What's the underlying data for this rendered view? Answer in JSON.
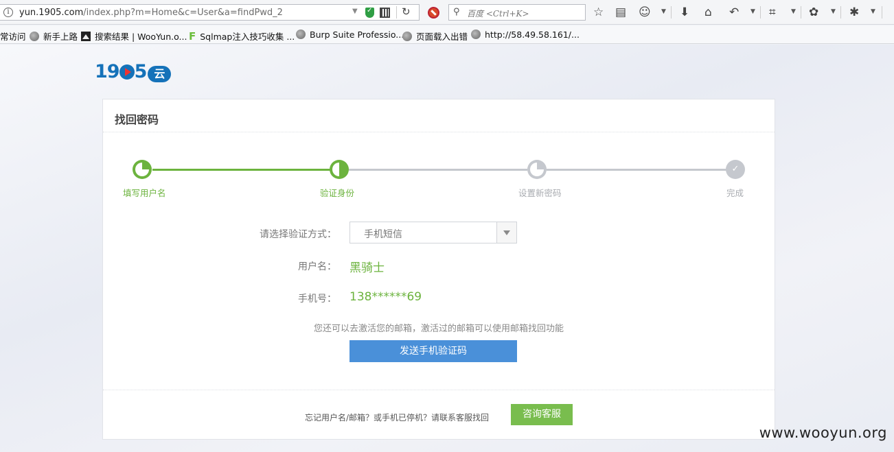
{
  "browser": {
    "url_host": "yun.1905.com",
    "url_path": "/index.php?m=Home&c=User&a=findPwd_2",
    "search_placeholder": "百度 <Ctrl+K>"
  },
  "bookmarks": [
    {
      "label": "常访问"
    },
    {
      "label": "新手上路"
    },
    {
      "label": "搜索结果 | WooYun.o..."
    },
    {
      "label": "Sqlmap注入技巧收集 ..."
    },
    {
      "label": "Burp Suite Professio..."
    },
    {
      "label": "页面载入出错"
    },
    {
      "label": "http://58.49.58.161/..."
    }
  ],
  "logo": {
    "prefix": "19",
    "suffix": "5",
    "cloud": "云"
  },
  "panel": {
    "title": "找回密码"
  },
  "steps": [
    {
      "label": "填写用户名",
      "state": "done"
    },
    {
      "label": "验证身份",
      "state": "active"
    },
    {
      "label": "设置新密码",
      "state": "pending"
    },
    {
      "label": "完成",
      "state": "pending"
    }
  ],
  "form": {
    "method_label": "请选择验证方式：",
    "method_value": "手机短信",
    "username_label": "用户名：",
    "username_value": "黑骑士",
    "phone_label": "手机号：",
    "phone_value": "138******69",
    "hint": "您还可以去激活您的邮箱，激活过的邮箱可以使用邮箱找回功能",
    "send_button": "发送手机验证码"
  },
  "footer": {
    "text": "忘记用户名/邮箱？或手机已停机？请联系客服找回",
    "help_button": "咨询客服"
  },
  "watermark": "www.wooyun.org",
  "colors": {
    "green": "#6cb33e",
    "blue": "#4a90d9",
    "brand": "#1572b9",
    "gray": "#c5c8ce"
  }
}
